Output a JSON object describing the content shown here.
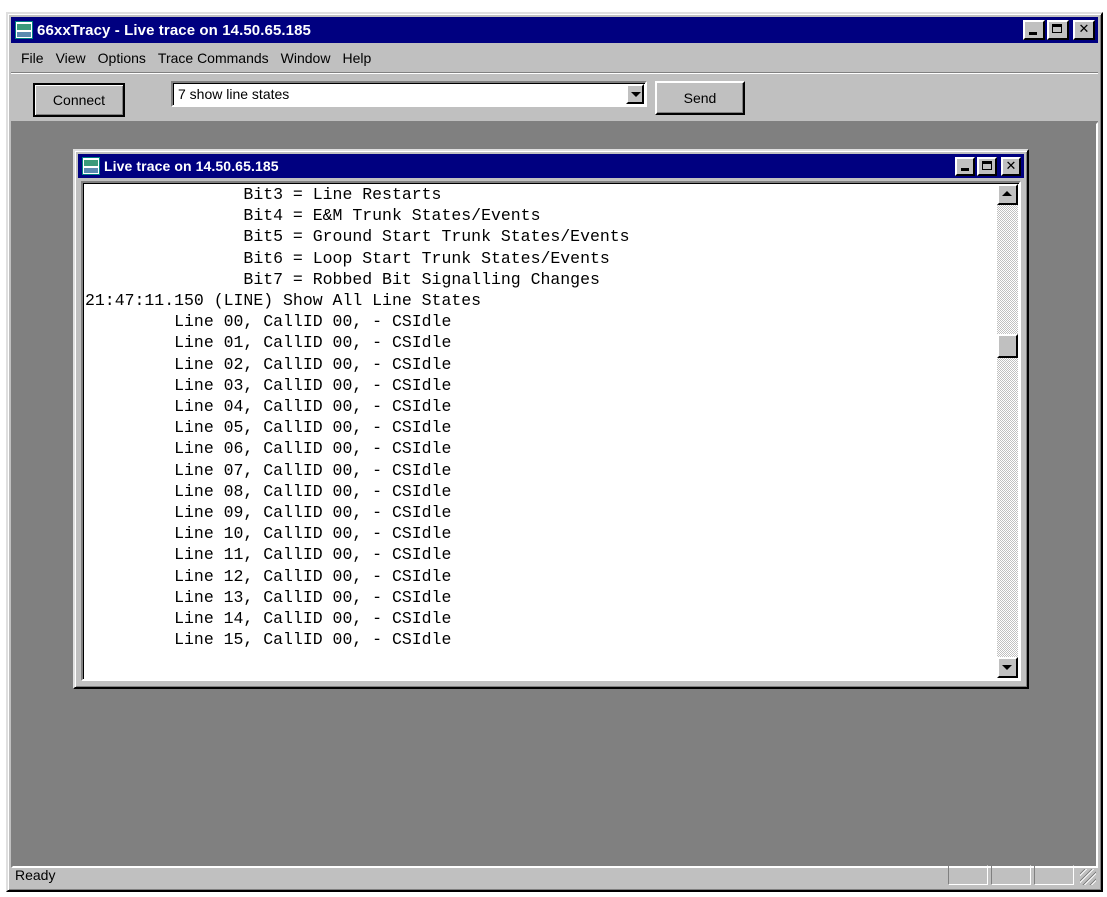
{
  "app": {
    "title": "66xxTracy - Live trace on 14.50.65.185",
    "menu": [
      "File",
      "View",
      "Options",
      "Trace Commands",
      "Window",
      "Help"
    ],
    "toolbar": {
      "connect_label": "Connect",
      "command_value": "7 show line states",
      "send_label": "Send"
    },
    "status": {
      "text": "Ready"
    }
  },
  "child": {
    "title": "Live trace on 14.50.65.185",
    "trace_lines": [
      "                Bit3 = Line Restarts",
      "                Bit4 = E&M Trunk States/Events",
      "                Bit5 = Ground Start Trunk States/Events",
      "                Bit6 = Loop Start Trunk States/Events",
      "                Bit7 = Robbed Bit Signalling Changes",
      "21:47:11.150 (LINE) Show All Line States",
      "         Line 00, CallID 00, - CSIdle",
      "         Line 01, CallID 00, - CSIdle",
      "         Line 02, CallID 00, - CSIdle",
      "         Line 03, CallID 00, - CSIdle",
      "         Line 04, CallID 00, - CSIdle",
      "         Line 05, CallID 00, - CSIdle",
      "         Line 06, CallID 00, - CSIdle",
      "         Line 07, CallID 00, - CSIdle",
      "         Line 08, CallID 00, - CSIdle",
      "         Line 09, CallID 00, - CSIdle",
      "         Line 10, CallID 00, - CSIdle",
      "         Line 11, CallID 00, - CSIdle",
      "         Line 12, CallID 00, - CSIdle",
      "         Line 13, CallID 00, - CSIdle",
      "         Line 14, CallID 00, - CSIdle",
      "         Line 15, CallID 00, - CSIdle"
    ]
  },
  "icons": {
    "app": "cisco-app-icon",
    "minimize": "minimize-icon",
    "maximize": "maximize-icon",
    "close": "close-icon",
    "dropdown": "chevron-down-icon",
    "scroll_up": "scroll-up-arrow-icon",
    "scroll_down": "scroll-down-arrow-icon",
    "size_grip": "resize-grip-icon"
  }
}
